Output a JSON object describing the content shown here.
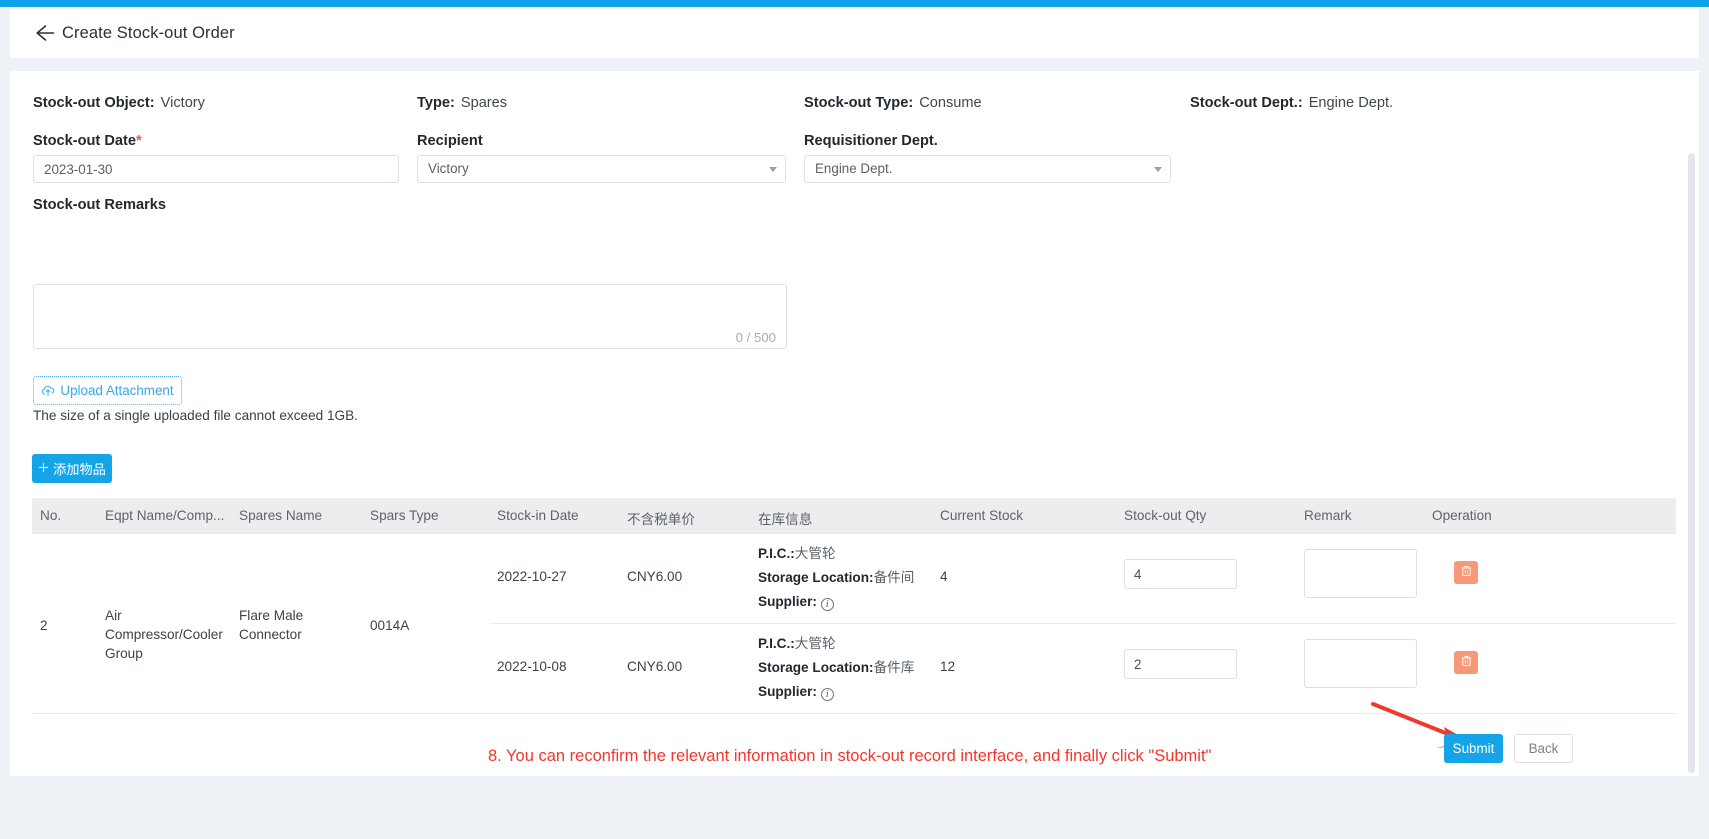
{
  "theme": {
    "accent": "#0fa2e9",
    "primary_button": "#15a4e8",
    "danger": "#f79877",
    "annotation": "#f4352c",
    "page_bg": "#eef1f5",
    "header_bg": "#ededef"
  },
  "header": {
    "back_icon": "arrow-left-icon",
    "title": "Create Stock-out Order"
  },
  "summary": [
    {
      "label": "Stock-out Object:",
      "value": "Victory"
    },
    {
      "label": "Type:",
      "value": "Spares"
    },
    {
      "label": "Stock-out Type:",
      "value": "Consume"
    },
    {
      "label": "Stock-out Dept.:",
      "value": "Engine Dept."
    }
  ],
  "form": {
    "stock_out_date": {
      "label": "Stock-out Date",
      "required_mark": "*",
      "value": "2023-01-30",
      "placeholder": ""
    },
    "recipient": {
      "label": "Recipient",
      "value": "Victory",
      "options": [
        "Victory"
      ]
    },
    "requisitioner_dept": {
      "label": "Requisitioner Dept.",
      "value": "Engine Dept.",
      "options": [
        "Engine Dept."
      ]
    },
    "remarks": {
      "label": "Stock-out Remarks",
      "value": "",
      "placeholder": "",
      "counter": "0 / 500"
    }
  },
  "upload": {
    "button_label": "Upload Attachment",
    "icon": "cloud-upload-icon",
    "hint": "The size of a single uploaded file cannot exceed 1GB."
  },
  "add_item_button": {
    "label": "添加物品",
    "icon": "plus-icon"
  },
  "table": {
    "columns": [
      "No.",
      "Eqpt Name/Comp...",
      "Spares Name",
      "Spars Type",
      "Stock-in Date",
      "不含税单价",
      "在库信息",
      "Current Stock",
      "Stock-out Qty",
      "Remark",
      "Operation"
    ],
    "rows": [
      {
        "no": "2",
        "eqpt_name": "Air Compressor/Cooler Group",
        "spares_name": "Flare Male Connector",
        "spars_type": "0014A",
        "batches": [
          {
            "stock_in_date": "2022-10-27",
            "unit_price": "CNY6.00",
            "pic_label": "P.I.C.:",
            "pic_value": "大管轮",
            "storage_label": "Storage Location:",
            "storage_value": "备件间",
            "supplier_label": "Supplier:",
            "supplier_value": "",
            "current_stock": "4",
            "stock_out_qty": "4",
            "remark": "",
            "delete_icon": "trash-icon"
          },
          {
            "stock_in_date": "2022-10-08",
            "unit_price": "CNY6.00",
            "pic_label": "P.I.C.:",
            "pic_value": "大管轮",
            "storage_label": "Storage Location:",
            "storage_value": "备件库",
            "supplier_label": "Supplier:",
            "supplier_value": "",
            "current_stock": "12",
            "stock_out_qty": "2",
            "remark": "",
            "delete_icon": "trash-icon"
          }
        ]
      }
    ]
  },
  "annotation": {
    "text": "8. You can reconfirm the relevant information in stock-out record interface, and finally click \"Submit\"",
    "arrow": "red-arrow-pointing-to-submit"
  },
  "footer": {
    "submit_label": "Submit",
    "back_label": "Back"
  }
}
